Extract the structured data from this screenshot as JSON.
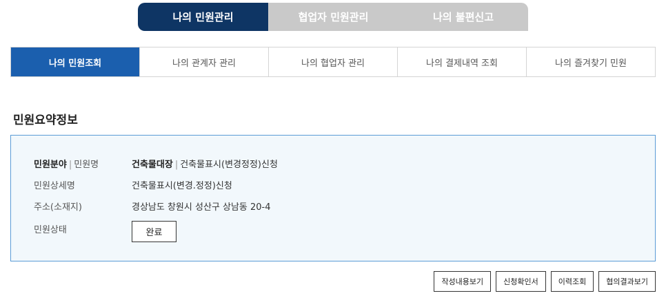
{
  "top_tabs": [
    {
      "label": "나의 민원관리",
      "active": true
    },
    {
      "label": "협업자 민원관리",
      "active": false
    },
    {
      "label": "나의 불편신고",
      "active": false
    }
  ],
  "sub_tabs": [
    {
      "label": "나의 민원조회",
      "active": true
    },
    {
      "label": "나의 관계자 관리",
      "active": false
    },
    {
      "label": "나의 협업자 관리",
      "active": false
    },
    {
      "label": "나의 결제내역 조회",
      "active": false
    },
    {
      "label": "나의 즐겨찾기 민원",
      "active": false
    }
  ],
  "summary": {
    "title": "민원요약정보",
    "field_label_bold": "민원분야",
    "field_label_rest": "민원명",
    "field_value_bold": "건축물대장",
    "field_value_rest": "건축물표시(변경정정)신청",
    "detail_label": "민원상세명",
    "detail_value": "건축물표시(변경.정정)신청",
    "address_label": "주소(소재지)",
    "address_value": "경상남도 창원시 성산구 상남동 20-4",
    "status_label": "민원상태",
    "status_value": "완료"
  },
  "buttons": {
    "view_content": "작성내용보기",
    "confirmation": "신청확인서",
    "history": "이력조회",
    "consult_result": "협의결과보기"
  },
  "colors": {
    "navy": "#0e3564",
    "tab_inactive": "#c9c9c9",
    "active_blue": "#1b5fae",
    "box_border": "#5a9bd6",
    "box_bg": "#f2f8fc"
  }
}
